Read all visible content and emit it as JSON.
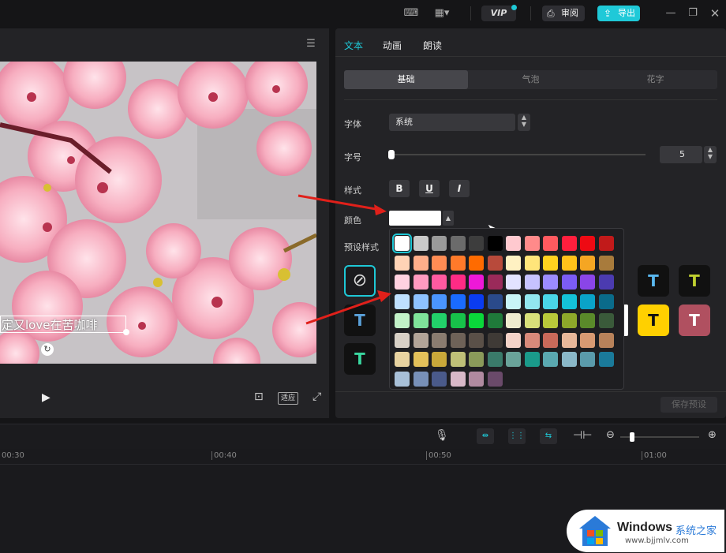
{
  "topbar": {
    "vip_label": "VIP",
    "review_label": "审阅",
    "export_label": "导出",
    "icons": [
      "keyboard-icon",
      "layout-icon",
      "minimize-icon",
      "restore-icon",
      "close-icon"
    ]
  },
  "preview": {
    "caption": "定又love在苦咖啡",
    "fit_label": "适应"
  },
  "panel": {
    "tabs": [
      "文本",
      "动画",
      "朗读"
    ],
    "subtabs": [
      "基础",
      "气泡",
      "花字"
    ],
    "font_label": "字体",
    "font_value": "系统",
    "size_label": "字号",
    "size_value": "5",
    "size_slider": 0.0,
    "style_label": "样式",
    "style_bold": "B",
    "style_underline": "U",
    "style_italic": "I",
    "color_label": "颜色",
    "selected_color": "#ffffff",
    "preset_label": "预设样式",
    "save_preset": "保存预设"
  },
  "palette": [
    [
      "#ffffff",
      "#c9c9c9",
      "#9a9a9a",
      "#6b6b6b",
      "#3d3d3d",
      "#000000",
      "#ffc9cf",
      "#ff8a8a",
      "#ff5a5f",
      "#ff1f3d",
      "#ee0a13",
      "#c11a1a"
    ],
    [
      "#ffd3b6",
      "#ffae8a",
      "#ff8c54",
      "#ff7a2a",
      "#ff6b00",
      "#b84a3b",
      "#fff1c2",
      "#ffe57a",
      "#ffd21f",
      "#ffc21a",
      "#f5a623",
      "#a87b3c"
    ],
    [
      "#ffd1e0",
      "#ff9ac0",
      "#ff5aa0",
      "#ff2b85",
      "#ee18d8",
      "#9a2a5a",
      "#e3e3ff",
      "#c6c2ff",
      "#9b8cff",
      "#7b5cf5",
      "#8a45e8",
      "#4b3bb0"
    ],
    [
      "#bfe0ff",
      "#8ec2ff",
      "#4a95ff",
      "#1a6bff",
      "#0a3cf0",
      "#2a4a8a",
      "#c8f4f7",
      "#92e6ef",
      "#4ad6e8",
      "#14c2d8",
      "#0aa3c8",
      "#0a6b8a"
    ],
    [
      "#c2f2c8",
      "#7fe39a",
      "#22d16a",
      "#17c24a",
      "#0ad83a",
      "#1f7a3a",
      "#efeccf",
      "#d8e07a",
      "#b8c93a",
      "#8ea82a",
      "#5a8a2a",
      "#3a5a3a"
    ],
    [
      "#d8d0c6",
      "#b2a498",
      "#8a7c70",
      "#6e6258",
      "#5a5048",
      "#3f3a36",
      "#f4d3c8",
      "#d88a7a",
      "#c96a5a",
      "#e8b89a",
      "#d89a72",
      "#b8825a"
    ],
    [
      "#e8d3a0",
      "#e3c05a",
      "#c9a83a",
      "#bfc078",
      "#8a9a5a",
      "#3a7a6a",
      "#6aa39a",
      "#1a9a8a",
      "#5aa8b0",
      "#8ab8c8",
      "#5a9aaa",
      "#1a7a9a"
    ],
    [
      "#a8c0d8",
      "#7890b8",
      "#4a5a8a",
      "#d8b8c8",
      "#b08aa0",
      "#6a4a6a"
    ]
  ],
  "presets": {
    "row1_right": [
      "T",
      "T"
    ],
    "row2_right": [
      "T",
      "T"
    ],
    "row2_left": "T",
    "row3_left": "T"
  },
  "timeline": {
    "ticks": [
      "00:30",
      "00:40",
      "00:50",
      "01:00"
    ]
  },
  "watermark": {
    "brand": "Windows",
    "site_cn": "系统之家",
    "url": "www.bjjmlv.com"
  }
}
